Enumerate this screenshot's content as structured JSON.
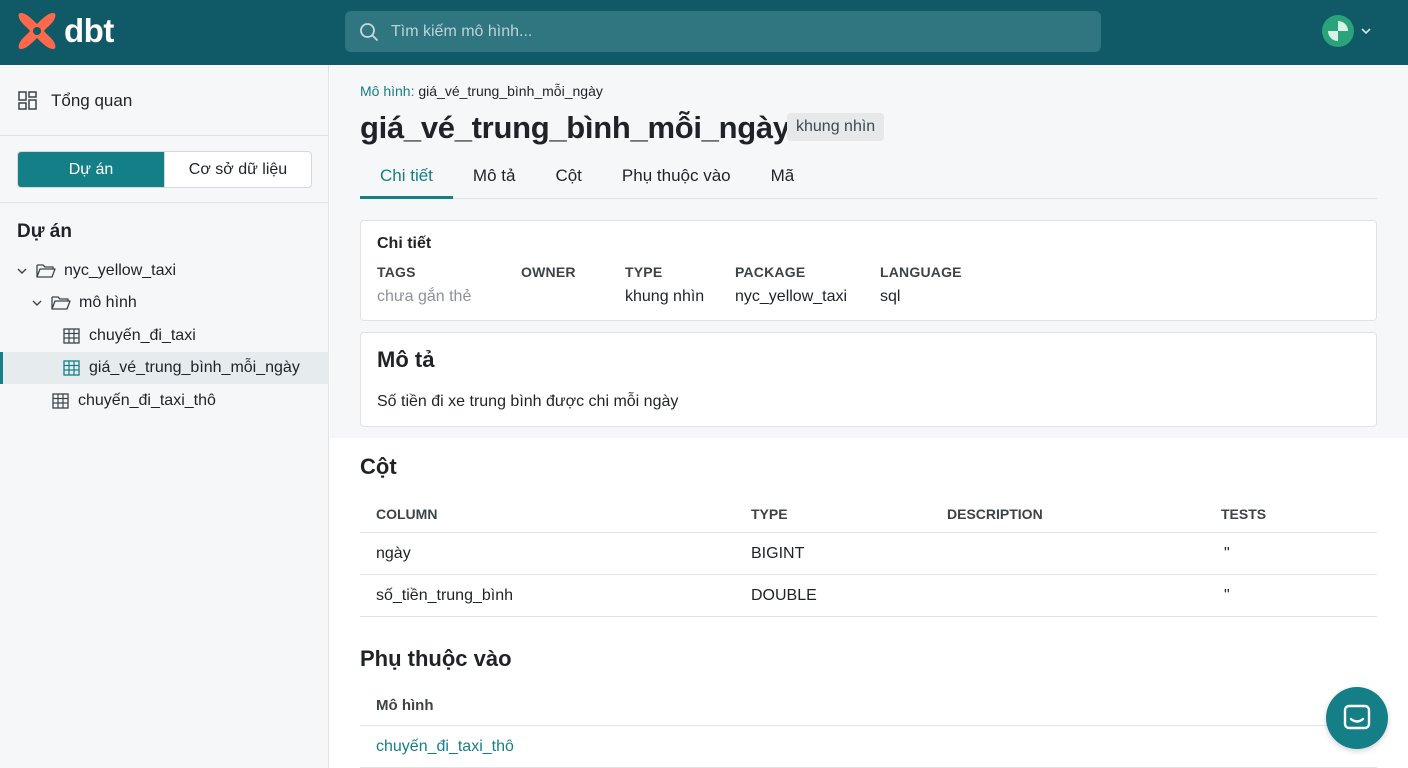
{
  "header": {
    "logo_text": "dbt",
    "search_placeholder": "Tìm kiếm mô hình..."
  },
  "sidebar": {
    "overview_label": "Tổng quan",
    "toggle": {
      "project": "Dự án",
      "database": "Cơ sở dữ liệu",
      "active": "project"
    },
    "tree_title": "Dự án",
    "tree": [
      {
        "label": "nyc_yellow_taxi",
        "type": "folder",
        "expanded": true
      },
      {
        "label": "mô hình",
        "type": "folder",
        "expanded": true
      },
      {
        "label": "chuyến_đi_taxi",
        "type": "model"
      },
      {
        "label": "giá_vé_trung_bình_mỗi_ngày",
        "type": "model",
        "selected": true
      },
      {
        "label": "chuyến_đi_taxi_thô",
        "type": "model"
      }
    ]
  },
  "main": {
    "breadcrumb_label": "Mô hình:",
    "breadcrumb_value": "giá_vé_trung_bình_mỗi_ngày",
    "title": "giá_vé_trung_bình_mỗi_ngày",
    "title_badge": "khung nhìn",
    "tabs": [
      "Chi tiết",
      "Mô tả",
      "Cột",
      "Phụ thuộc vào",
      "Mã"
    ],
    "active_tab": "Chi tiết",
    "details": {
      "heading": "Chi tiết",
      "fields": [
        {
          "label": "TAGS",
          "value": "chưa gắn thẻ"
        },
        {
          "label": "OWNER",
          "value": ""
        },
        {
          "label": "TYPE",
          "value": "khung nhìn"
        },
        {
          "label": "PACKAGE",
          "value": "nyc_yellow_taxi"
        },
        {
          "label": "LANGUAGE",
          "value": "sql"
        }
      ]
    },
    "description": {
      "heading": "Mô tả",
      "text": "Số tiền đi xe trung bình được chi mỗi ngày"
    },
    "columns": {
      "heading": "Cột",
      "headers": [
        "COLUMN",
        "TYPE",
        "DESCRIPTION",
        "TESTS"
      ],
      "rows": [
        {
          "column": "ngày",
          "type": "BIGINT",
          "description": "",
          "tests": "\""
        },
        {
          "column": "số_tiền_trung_bình",
          "type": "DOUBLE",
          "description": "",
          "tests": "\""
        }
      ]
    },
    "depends_on": {
      "heading": "Phụ thuộc vào",
      "header": "Mô hình",
      "rows": [
        "chuyến_đi_taxi_thô"
      ]
    }
  },
  "colors": {
    "header_bg": "#0f5a66",
    "accent": "#147f86",
    "logo_orange": "#ff694b"
  }
}
